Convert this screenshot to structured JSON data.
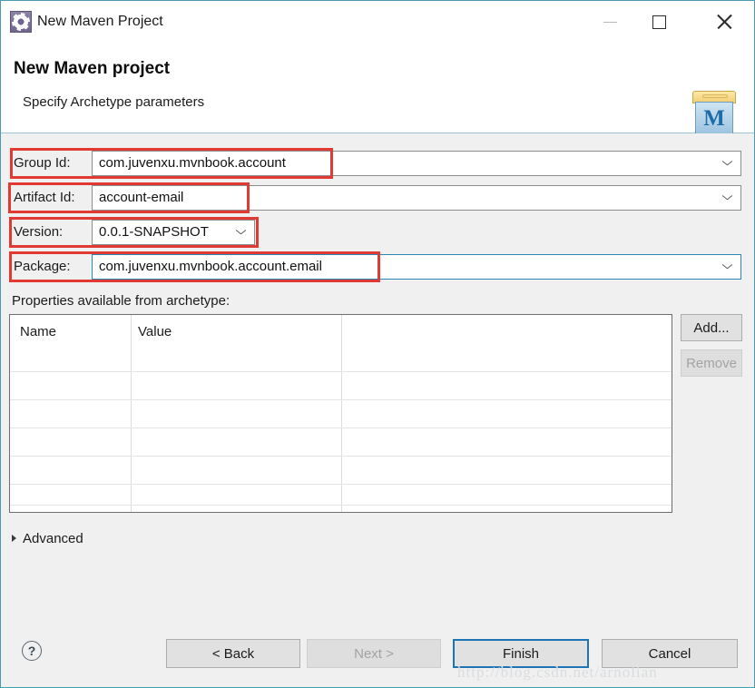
{
  "window": {
    "title": "New Maven Project",
    "icon": "maven-gear-icon",
    "controls": {
      "minimize": "minimize-icon",
      "maximize": "maximize-icon",
      "close": "close-icon"
    }
  },
  "header": {
    "title": "New Maven project",
    "subtitle": "Specify Archetype parameters",
    "logo_letter": "M"
  },
  "form": {
    "fields": [
      {
        "label": "Group Id:",
        "value": "com.juvenxu.mvnbook.account"
      },
      {
        "label": "Artifact Id:",
        "value": "account-email"
      },
      {
        "label": "Version:",
        "value": "0.0.1-SNAPSHOT"
      },
      {
        "label": "Package:",
        "value": "com.juvenxu.mvnbook.account.email"
      }
    ]
  },
  "properties": {
    "label": "Properties available from archetype:",
    "columns": [
      "Name",
      "Value",
      ""
    ],
    "rows": [],
    "buttons": {
      "add": "Add...",
      "remove": "Remove"
    }
  },
  "advanced": {
    "label": "Advanced",
    "expander": "triangle-right-icon"
  },
  "footer": {
    "help": "?",
    "back": "< Back",
    "next": "Next >",
    "finish": "Finish",
    "cancel": "Cancel"
  },
  "watermark": "http://blog.csdn.net/arnolian",
  "colors": {
    "window_border": "#4a9bb0",
    "annotation": "#e03a33",
    "focus": "#2b86b8",
    "default_button": "#1e73b4",
    "body": "#f0f0f0"
  }
}
